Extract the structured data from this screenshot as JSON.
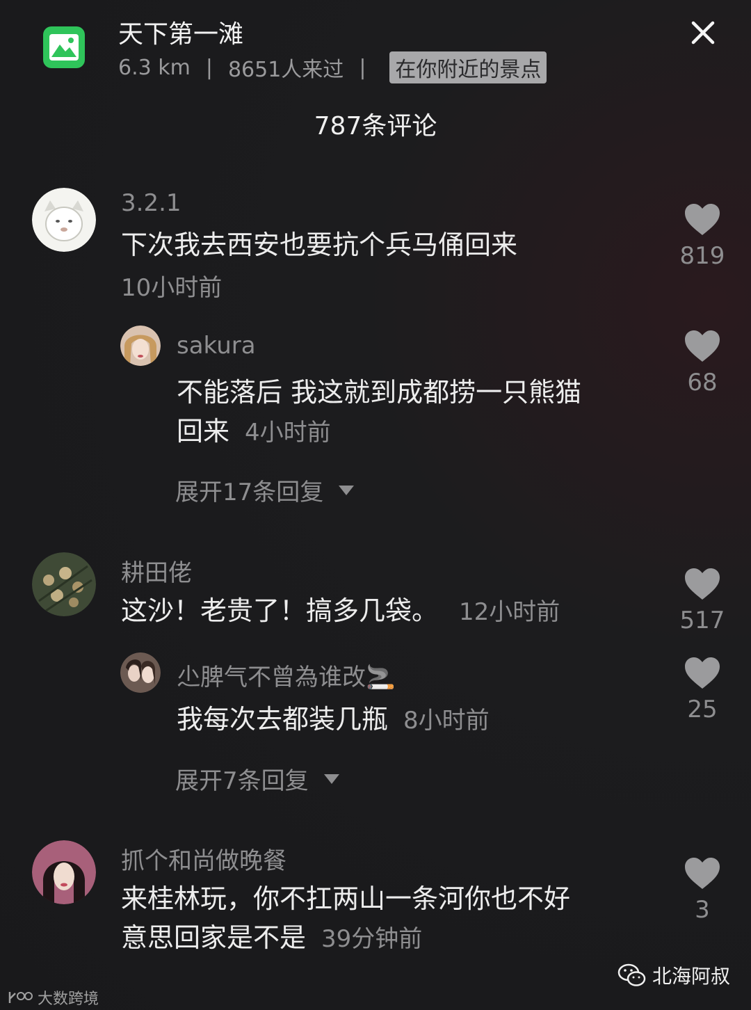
{
  "header": {
    "title": "天下第一滩",
    "distance": "6.3 km",
    "separator": "|",
    "visitors": "8651人来过",
    "badge": "在你附近的景点",
    "comment_count": "787条评论"
  },
  "comments": [
    {
      "user": "3.2.1",
      "text": "下次我去西安也要抗个兵马俑回来",
      "time": "10小时前",
      "likes": "819",
      "reply": {
        "user": "sakura",
        "text_line1": "不能落后 我这就到成都捞一只熊猫",
        "text_line2": "回来",
        "time": "4小时前",
        "likes": "68"
      },
      "expand": "展开17条回复"
    },
    {
      "user": "耕田佬",
      "text": "这沙！老贵了！搞多几袋。",
      "time": "12小时前",
      "likes": "517",
      "reply": {
        "user": "尐脾气不曾為谁改🚬",
        "text": "我每次去都装几瓶",
        "time": "8小时前",
        "likes": "25"
      },
      "expand": "展开7条回复"
    },
    {
      "user": "抓个和尚做晚餐",
      "text_line1": "来桂林玩，你不扛两山一条河你也不好",
      "text_line2": "意思回家是不是",
      "time": "39分钟前",
      "likes": "3"
    }
  ],
  "watermarks": {
    "right": "北海阿叔",
    "left": "大数跨境"
  },
  "icons": {
    "app": "image-icon",
    "close": "close-icon",
    "like": "heart-icon",
    "expand": "triangle-down-icon",
    "wechat": "wechat-icon"
  },
  "colors": {
    "background": "#1c1c1e",
    "app_icon": "#2fc45a",
    "secondary_text": "#8e8e90",
    "badge_bg": "#a8a8aa"
  }
}
